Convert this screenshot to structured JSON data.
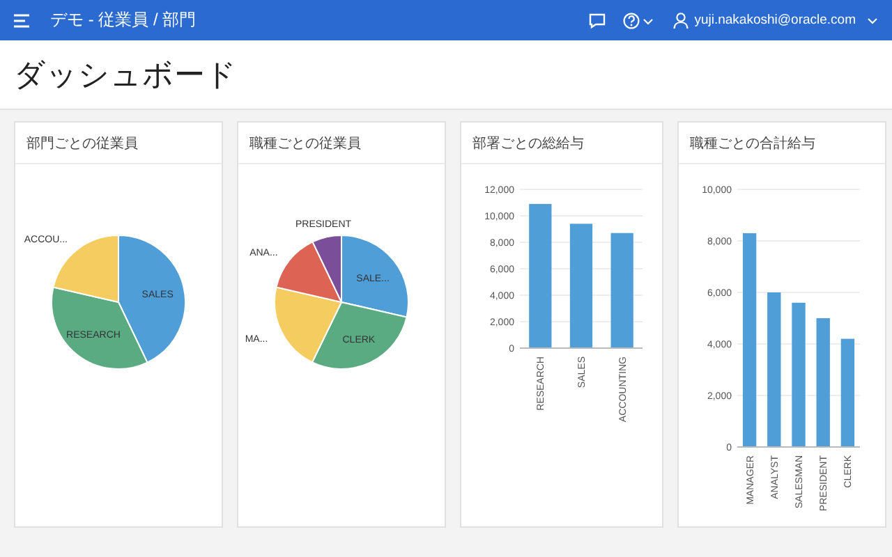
{
  "header": {
    "title": "デモ - 従業員 / 部門",
    "user": "yuji.nakakoshi@oracle.com"
  },
  "page_title": "ダッシュボード",
  "cards": [
    {
      "title": "部門ごとの従業員",
      "chart_data": {
        "type": "pie",
        "categories": [
          "SALES",
          "RESEARCH",
          "ACCOU..."
        ],
        "values": [
          42.9,
          35.7,
          21.4
        ]
      }
    },
    {
      "title": "職種ごとの従業員",
      "chart_data": {
        "type": "pie",
        "categories": [
          "SALE...",
          "CLERK",
          "MA...",
          "ANA...",
          "PRESIDENT"
        ],
        "values": [
          28.6,
          28.6,
          21.4,
          14.3,
          7.1
        ]
      }
    },
    {
      "title": "部署ごとの総給与",
      "chart_data": {
        "type": "bar",
        "categories": [
          "RESEARCH",
          "SALES",
          "ACCOUNTING"
        ],
        "values": [
          10900,
          9400,
          8700
        ],
        "grid": true,
        "ylim": [
          0,
          12000
        ],
        "yticks": [
          {
            "value": 0,
            "label": "0"
          },
          {
            "value": 2000,
            "label": "2,000"
          },
          {
            "value": 4000,
            "label": "4,000"
          },
          {
            "value": 6000,
            "label": "6,000"
          },
          {
            "value": 8000,
            "label": "8,000"
          },
          {
            "value": 10000,
            "label": "10,000"
          },
          {
            "value": 12000,
            "label": "12,000"
          }
        ]
      }
    },
    {
      "title": "職種ごとの合計給与",
      "chart_data": {
        "type": "bar",
        "categories": [
          "MANAGER",
          "ANALYST",
          "SALESMAN",
          "PRESIDENT",
          "CLERK"
        ],
        "values": [
          8300,
          6000,
          5600,
          5000,
          4200
        ],
        "grid": true,
        "ylim": [
          0,
          10000
        ],
        "yticks": [
          {
            "value": 0,
            "label": "0"
          },
          {
            "value": 2000,
            "label": "2,000"
          },
          {
            "value": 4000,
            "label": "4,000"
          },
          {
            "value": 6000,
            "label": "6,000"
          },
          {
            "value": 8000,
            "label": "8,000"
          },
          {
            "value": 10000,
            "label": "10,000"
          }
        ]
      }
    }
  ]
}
